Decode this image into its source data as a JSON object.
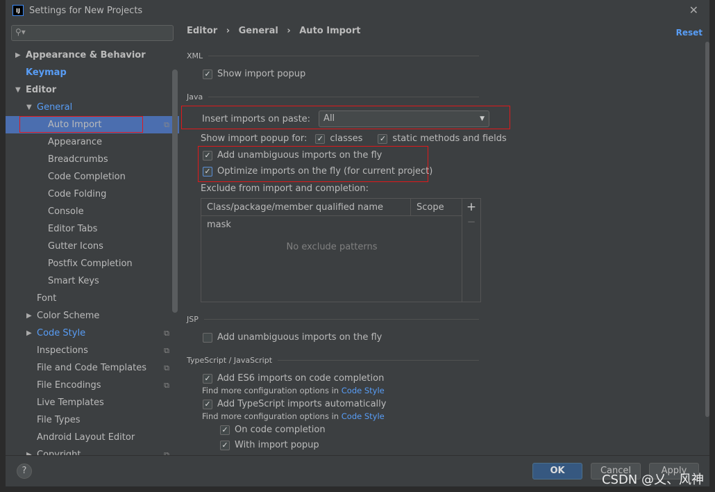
{
  "window": {
    "title": "Settings for New Projects",
    "logo": "IJ"
  },
  "sidebar": {
    "search_placeholder": "Q▾",
    "items": [
      {
        "label": "Appearance & Behavior",
        "level": 0,
        "arrow": "▶",
        "style": "bold"
      },
      {
        "label": "Keymap",
        "level": 0,
        "arrow": "",
        "style": "bold-link"
      },
      {
        "label": "Editor",
        "level": 0,
        "arrow": "▼",
        "style": "bold"
      },
      {
        "label": "General",
        "level": 1,
        "arrow": "▼",
        "style": "link"
      },
      {
        "label": "Auto Import",
        "level": 2,
        "arrow": "",
        "style": "selected",
        "copy": true
      },
      {
        "label": "Appearance",
        "level": 2
      },
      {
        "label": "Breadcrumbs",
        "level": 2
      },
      {
        "label": "Code Completion",
        "level": 2
      },
      {
        "label": "Code Folding",
        "level": 2
      },
      {
        "label": "Console",
        "level": 2
      },
      {
        "label": "Editor Tabs",
        "level": 2
      },
      {
        "label": "Gutter Icons",
        "level": 2
      },
      {
        "label": "Postfix Completion",
        "level": 2
      },
      {
        "label": "Smart Keys",
        "level": 2
      },
      {
        "label": "Font",
        "level": 1
      },
      {
        "label": "Color Scheme",
        "level": 1,
        "arrow": "▶"
      },
      {
        "label": "Code Style",
        "level": 1,
        "arrow": "▶",
        "style": "link",
        "copy": true
      },
      {
        "label": "Inspections",
        "level": 1,
        "copy": true
      },
      {
        "label": "File and Code Templates",
        "level": 1,
        "copy": true
      },
      {
        "label": "File Encodings",
        "level": 1,
        "copy": true
      },
      {
        "label": "Live Templates",
        "level": 1
      },
      {
        "label": "File Types",
        "level": 1
      },
      {
        "label": "Android Layout Editor",
        "level": 1
      },
      {
        "label": "Copyright",
        "level": 1,
        "arrow": "▶",
        "copy": true
      }
    ]
  },
  "main": {
    "breadcrumb": [
      "Editor",
      "General",
      "Auto Import"
    ],
    "reset": "Reset",
    "xml": {
      "title": "XML",
      "show_popup": "Show import popup"
    },
    "java": {
      "title": "Java",
      "insert_label": "Insert imports on paste:",
      "insert_value": "All",
      "show_for": "Show import popup for:",
      "classes": "classes",
      "static": "static methods and fields",
      "unambiguous": "Add unambiguous imports on the fly",
      "optimize": "Optimize imports on the fly (for current project)",
      "exclude_label": "Exclude from import and completion:",
      "col_mask": "Class/package/member qualified name mask",
      "col_scope": "Scope",
      "empty": "No exclude patterns",
      "add": "+",
      "remove": "−"
    },
    "jsp": {
      "title": "JSP",
      "unambiguous": "Add unambiguous imports on the fly"
    },
    "ts": {
      "title": "TypeScript / JavaScript",
      "es6": "Add ES6 imports on code completion",
      "more": "Find more configuration options in",
      "link": "Code Style",
      "tsauto": "Add TypeScript imports automatically",
      "on_completion": "On code completion",
      "with_popup": "With import popup"
    }
  },
  "footer": {
    "help": "?",
    "ok": "OK",
    "cancel": "Cancel",
    "apply": "Apply"
  },
  "watermark": "CSDN @乂、风神",
  "colors": {
    "selection": "#4b6eaf",
    "link": "#589df6",
    "highlight_box": "#e0191b"
  }
}
